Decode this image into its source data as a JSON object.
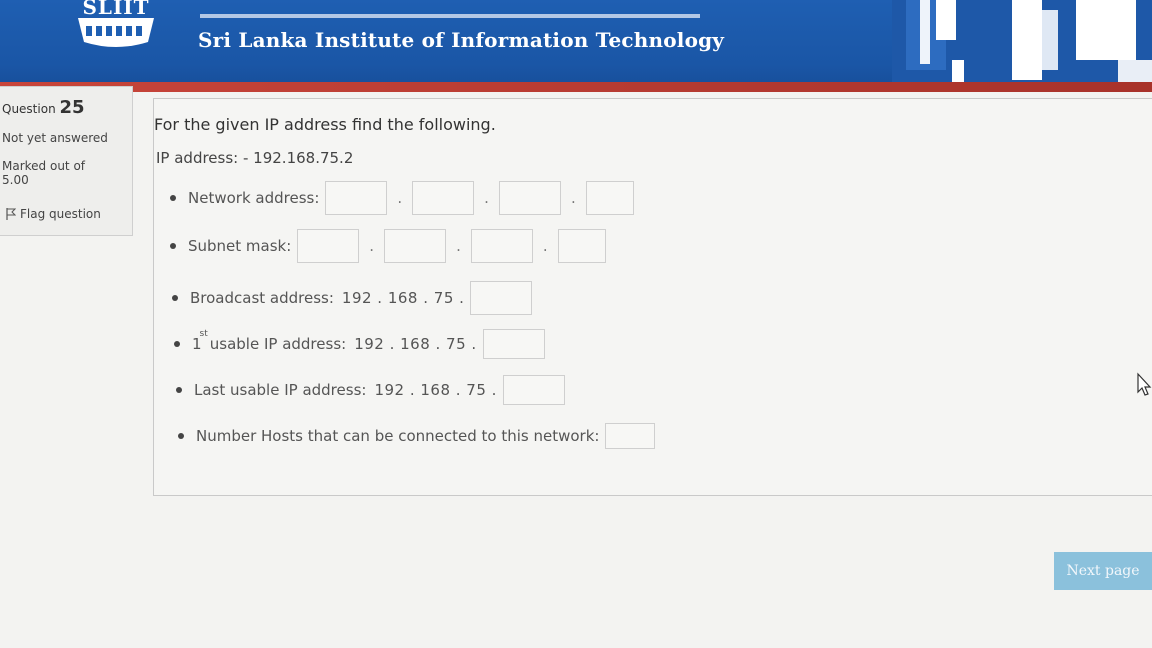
{
  "header": {
    "logo_text": "SLIIT",
    "institution": "Sri Lanka Institute of Information Technology"
  },
  "question_info": {
    "label": "Question",
    "number": "25",
    "state": "Not yet answered",
    "grade": "Marked out of 5.00",
    "flag_label": "Flag question"
  },
  "question": {
    "prompt": "For the given IP address find the following.",
    "ip_line": "IP address: - 192.168.75.2",
    "network_label": "Network address:",
    "subnet_label": "Subnet mask:",
    "broadcast_label": "Broadcast address:",
    "broadcast_prefix": "192 . 168 . 75 .",
    "first_label_num": "1",
    "first_label_sup": "st",
    "first_label_text": "usable IP address:",
    "first_prefix": "192 . 168 . 75 .",
    "last_label": "Last usable IP address:",
    "last_prefix": "192 . 168 . 75 .",
    "hosts_label": "Number Hosts that can be connected to this network:"
  },
  "navigation": {
    "next_label": "Next page"
  },
  "colors": {
    "header_blue": "#1f5fb2",
    "header_red": "#c8453a",
    "next_button": "#8bc1dc"
  }
}
